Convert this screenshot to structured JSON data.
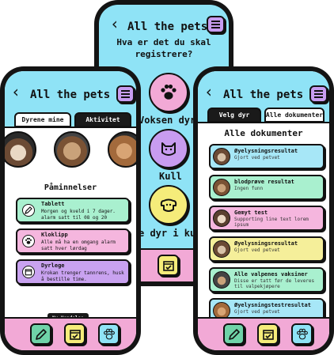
{
  "app_title": "All the pets",
  "register": {
    "question": "Hva er det du skal registrere?",
    "options": [
      {
        "label": "Voksen dyr",
        "icon": "paw-icon",
        "color": "#f2a9d6"
      },
      {
        "label": "Kull",
        "icon": "cat-icon",
        "color": "#c89cf0"
      },
      {
        "label": "e dyr i ku",
        "icon": "dog-icon",
        "color": "#f5ec7a"
      }
    ]
  },
  "my_pets": {
    "tabs": [
      "Dyrene mine",
      "Aktivitet"
    ],
    "reminders_title": "Påminnelser",
    "reminders": [
      {
        "title": "Tablett",
        "subtitle": "Morgen og kveld i 7 dager. alarm satt til 08 og 20",
        "icon": "pencil-icon",
        "color": "#a9f0cf"
      },
      {
        "title": "Kloklipp",
        "subtitle": "Alle må ha en omgang alarm satt hver lørdag",
        "icon": "paw-icon",
        "color": "#f5b6de"
      },
      {
        "title": "Dyrlege",
        "subtitle": "Krokan trenger tannrens, husk å bestille time.",
        "icon": "calendar-icon",
        "color": "#c9a2f0"
      }
    ],
    "new_event_label": "Ny Hendelse"
  },
  "documents": {
    "tabs": [
      "Velg dyr",
      "Alle dokumenter"
    ],
    "title": "Alle dokumenter",
    "items": [
      {
        "title": "Øyelysningsresultat",
        "subtitle": "Gjort ved petvet",
        "color": "#a7e7f7"
      },
      {
        "title": "blodprøve resultat",
        "subtitle": "Ingen funn",
        "color": "#a9f0cf"
      },
      {
        "title": "Gemyt test",
        "subtitle": "Supporting line text lorem ipsum",
        "color": "#f5b6de"
      },
      {
        "title": "Øyelysningsresultat",
        "subtitle": "Gjort ved petvet",
        "color": "#f5ef9a"
      },
      {
        "title": "Alle valpenes vaksiner",
        "subtitle": "Disse er tatt før de leveres til valpekjøpere",
        "color": "#a9f0cf"
      },
      {
        "title": "Øyelysningstestresultat",
        "subtitle": "Gjort ved petvet",
        "color": "#a7e7f7"
      }
    ]
  },
  "footer_icons": [
    "pencil-icon",
    "calendar-icon",
    "paw-icon"
  ],
  "colors": {
    "header": "#8fe3f6",
    "footer": "#f2a9d6",
    "menu": "#c89cf0"
  }
}
